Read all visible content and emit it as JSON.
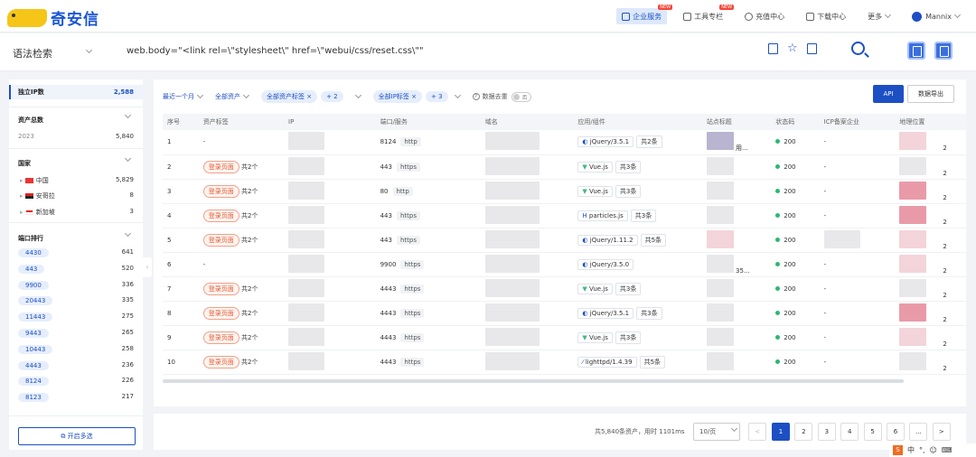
{
  "brand": {
    "name": "奇安信"
  },
  "topnav": {
    "enterprise": "企业服务",
    "tools": "工具专栏",
    "recharge": "充值中心",
    "download": "下载中心",
    "more": "更多",
    "user": "Mannix",
    "new_badge": "NEW"
  },
  "search": {
    "mode": "语法检索",
    "query": "web.body=\"<link rel=\\\"stylesheet\\\" href=\\\"webui/css/reset.css\\\"\""
  },
  "sidebar": {
    "unique_ip_label": "独立IP数",
    "unique_ip_value": "2,588",
    "asset_total_label": "资产总数",
    "year": "2023",
    "year_value": "5,840",
    "country_label": "国家",
    "countries": [
      {
        "name": "中国",
        "value": "5,829"
      },
      {
        "name": "安哥拉",
        "value": "8"
      },
      {
        "name": "新加坡",
        "value": "3"
      }
    ],
    "port_label": "端口排行",
    "ports": [
      {
        "port": "4430",
        "value": "641"
      },
      {
        "port": "443",
        "value": "520"
      },
      {
        "port": "9900",
        "value": "336"
      },
      {
        "port": "20443",
        "value": "335"
      },
      {
        "port": "11443",
        "value": "275"
      },
      {
        "port": "9443",
        "value": "265"
      },
      {
        "port": "10443",
        "value": "258"
      },
      {
        "port": "4443",
        "value": "236"
      },
      {
        "port": "8124",
        "value": "226"
      },
      {
        "port": "8123",
        "value": "217"
      }
    ],
    "multi_select": "开启多选"
  },
  "filters": {
    "time": "最近一个月",
    "asset": "全部资产",
    "asset_tag": "全部资产标签",
    "plus2": "+ 2",
    "ip_tag": "全部IP标签",
    "plus3": "+ 3",
    "dedupe": "数据去重",
    "no": "否",
    "api": "API",
    "export": "数据导出"
  },
  "columns": [
    "序号",
    "资产标签",
    "IP",
    "端口/服务",
    "域名",
    "应用/组件",
    "站点标题",
    "状态码",
    "ICP备案企业",
    "地理位置"
  ],
  "rows": [
    {
      "no": "1",
      "tag": "",
      "tag_count": "",
      "dash": "-",
      "port": "8124",
      "svc": "http",
      "comp": "jQuery/3.5.1",
      "count": "共2条",
      "title": "用...",
      "status": "200",
      "icp": "-",
      "geo": "2"
    },
    {
      "no": "2",
      "tag": "登录页面",
      "tag_count": "共2个",
      "dash": "",
      "port": "443",
      "svc": "https",
      "comp": "Vue.js",
      "count": "共3条",
      "title": "",
      "status": "200",
      "icp": "-",
      "geo": "2"
    },
    {
      "no": "3",
      "tag": "登录页面",
      "tag_count": "共2个",
      "dash": "",
      "port": "80",
      "svc": "http",
      "comp": "Vue.js",
      "count": "共3条",
      "title": "",
      "status": "200",
      "icp": "-",
      "geo": "2"
    },
    {
      "no": "4",
      "tag": "登录页面",
      "tag_count": "共2个",
      "dash": "",
      "port": "443",
      "svc": "https",
      "comp": "particles.js",
      "count": "共3条",
      "title": "",
      "status": "200",
      "icp": "-",
      "geo": "2"
    },
    {
      "no": "5",
      "tag": "登录页面",
      "tag_count": "共2个",
      "dash": "",
      "port": "443",
      "svc": "https",
      "comp": "jQuery/1.11.2",
      "count": "共5条",
      "title": "",
      "status": "200",
      "icp": "",
      "geo": "2"
    },
    {
      "no": "6",
      "tag": "",
      "tag_count": "",
      "dash": "-",
      "port": "9900",
      "svc": "https",
      "comp": "jQuery/3.5.0",
      "count": "",
      "title": "35...",
      "status": "200",
      "icp": "-",
      "geo": "2"
    },
    {
      "no": "7",
      "tag": "登录页面",
      "tag_count": "共2个",
      "dash": "",
      "port": "4443",
      "svc": "https",
      "comp": "Vue.js",
      "count": "共3条",
      "title": "",
      "status": "200",
      "icp": "-",
      "geo": "2"
    },
    {
      "no": "8",
      "tag": "登录页面",
      "tag_count": "共2个",
      "dash": "",
      "port": "4443",
      "svc": "https",
      "comp": "jQuery/3.5.1",
      "count": "共3条",
      "title": "",
      "status": "200",
      "icp": "-",
      "geo": "2"
    },
    {
      "no": "9",
      "tag": "登录页面",
      "tag_count": "共2个",
      "dash": "",
      "port": "4443",
      "svc": "https",
      "comp": "Vue.js",
      "count": "共3条",
      "title": "",
      "status": "200",
      "icp": "-",
      "geo": "2"
    },
    {
      "no": "10",
      "tag": "登录页面",
      "tag_count": "共2个",
      "dash": "",
      "port": "4443",
      "svc": "https",
      "comp": "lighttpd/1.4.39",
      "count": "共5条",
      "title": "",
      "status": "200",
      "icp": "-",
      "geo": "2"
    }
  ],
  "pager": {
    "info": "共5,840条资产，用时 1101ms",
    "size": "10/页",
    "pages": [
      "1",
      "2",
      "3",
      "4",
      "5",
      "6",
      "...",
      ">"
    ],
    "prev": "<"
  },
  "ime": {
    "s": "S",
    "lang": "中"
  }
}
